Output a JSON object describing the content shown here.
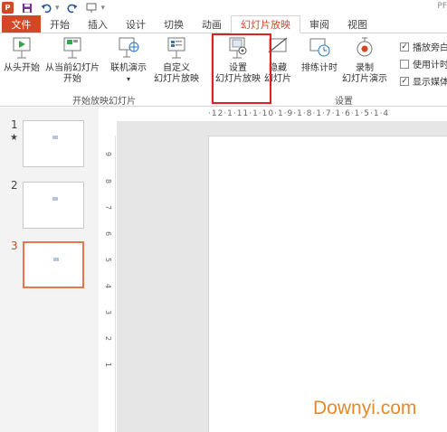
{
  "qat": {
    "app_icon_text": "P",
    "cut_label": "PF"
  },
  "tabs": [
    {
      "label": "文件"
    },
    {
      "label": "开始"
    },
    {
      "label": "插入"
    },
    {
      "label": "设计"
    },
    {
      "label": "切换"
    },
    {
      "label": "动画"
    },
    {
      "label": "幻灯片放映"
    },
    {
      "label": "审阅"
    },
    {
      "label": "视图"
    }
  ],
  "ribbon": {
    "from_start_l1": "从头开始",
    "from_current_l1": "从当前幻灯片",
    "from_current_l2": "开始",
    "online_l1": "联机演示",
    "custom_l1": "自定义",
    "custom_l2": "幻灯片放映",
    "group_start_label": "开始放映幻灯片",
    "setup_l1": "设置",
    "setup_l2": "幻灯片放映",
    "hide_l1": "隐藏",
    "hide_l2": "幻灯片",
    "rehearse_l1": "排练计时",
    "record_l1": "录制",
    "record_l2": "幻灯片演示",
    "group_setup_label": "设置",
    "check_play": "播放旁白",
    "check_timing": "使用计时",
    "check_media": "显示媒体"
  },
  "thumbs": [
    {
      "num": "1",
      "star": "★"
    },
    {
      "num": "2"
    },
    {
      "num": "3"
    }
  ],
  "hruler_text": "·12·1·11·1·10·1·9·1·8·1·7·1·6·1·5·1·4",
  "vruler": [
    "9",
    "8",
    "7",
    "6",
    "5",
    "4",
    "3",
    "2",
    "1"
  ],
  "watermark": "Downyi.com",
  "colors": {
    "accent": "#d24726",
    "highlight": "#e02020"
  }
}
